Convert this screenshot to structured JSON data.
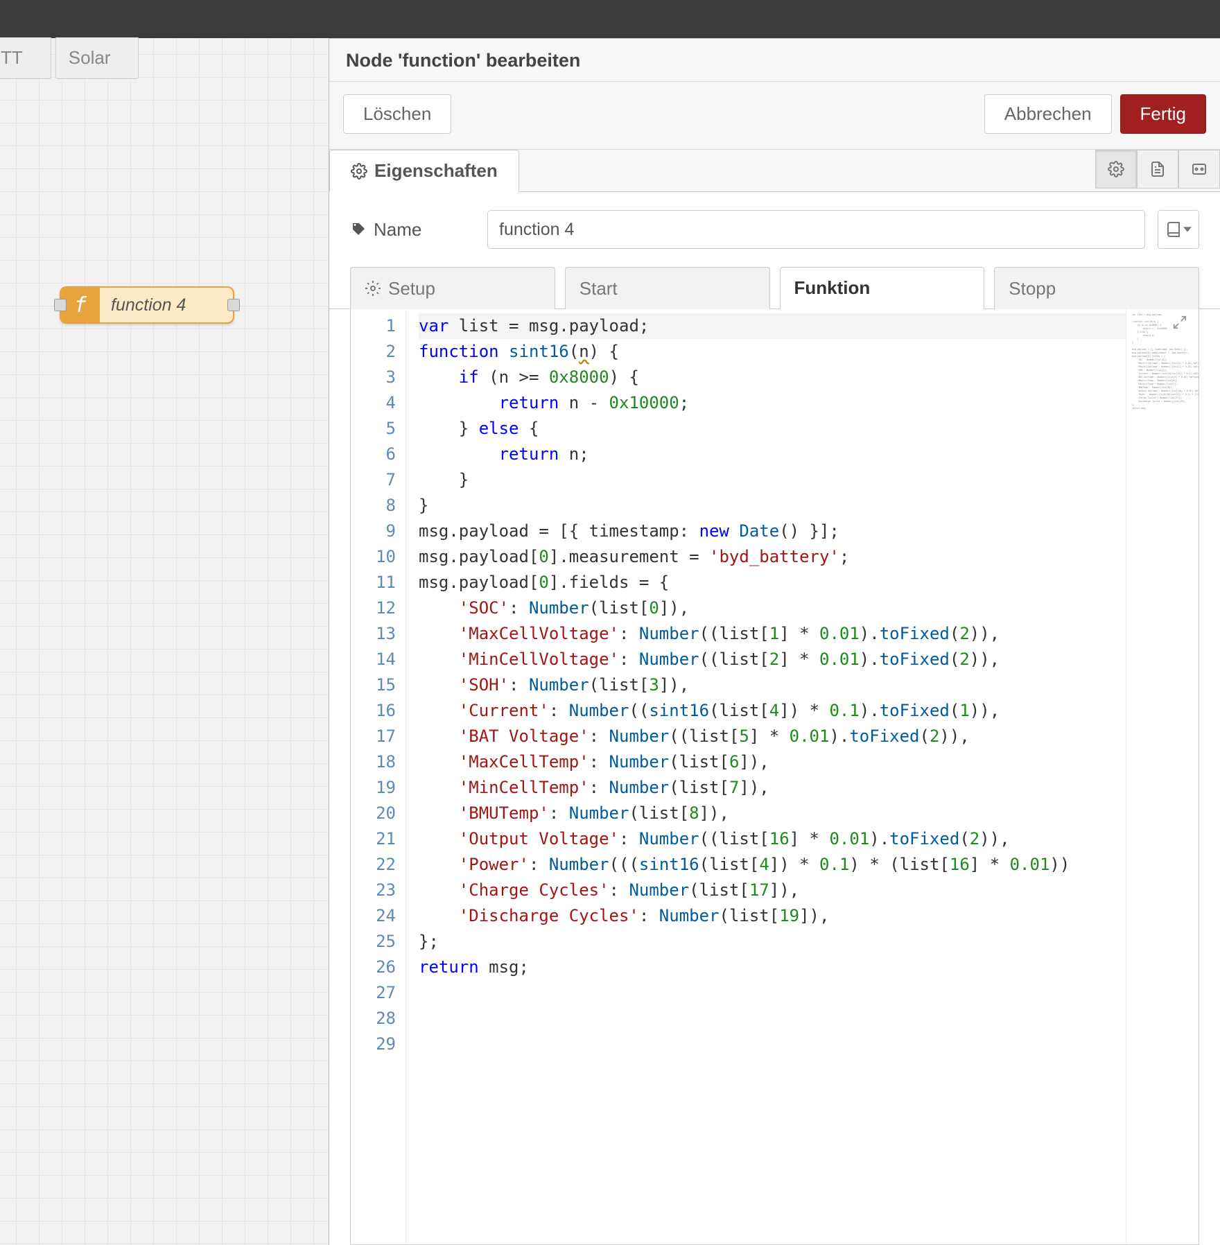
{
  "topbar": {},
  "workspace": {
    "tabs": [
      "TT",
      "Solar"
    ],
    "node": {
      "label": "function 4"
    }
  },
  "panel": {
    "title": "Node 'function' bearbeiten",
    "buttons": {
      "delete": "Löschen",
      "cancel": "Abbrechen",
      "done": "Fertig"
    },
    "propsTab": "Eigenschaften",
    "nameLabel": "Name",
    "nameValue": "function 4",
    "codeTabs": {
      "setup": "Setup",
      "start": "Start",
      "func": "Funktion",
      "stop": "Stopp"
    },
    "code": {
      "lines": [
        "var list = msg.payload;",
        "",
        "function sint16(n) {",
        "    if (n >= 0x8000) {",
        "        return n - 0x10000;",
        "    } else {",
        "        return n;",
        "    }",
        "}",
        "",
        "msg.payload = [{ timestamp: new Date() }];",
        "msg.payload[0].measurement = 'byd_battery';",
        "msg.payload[0].fields = {",
        "    'SOC': Number(list[0]),",
        "    'MaxCellVoltage': Number((list[1] * 0.01).toFixed(2)),",
        "    'MinCellVoltage': Number((list[2] * 0.01).toFixed(2)),",
        "    'SOH': Number(list[3]),",
        "    'Current': Number((sint16(list[4]) * 0.1).toFixed(1)),",
        "    'BAT Voltage': Number((list[5] * 0.01).toFixed(2)),",
        "    'MaxCellTemp': Number(list[6]),",
        "    'MinCellTemp': Number(list[7]),",
        "    'BMUTemp': Number(list[8]),",
        "    'Output Voltage': Number((list[16] * 0.01).toFixed(2)),",
        "    'Power': Number(((sint16(list[4]) * 0.1) * (list[16] * 0.01))",
        "    'Charge Cycles': Number(list[17]),",
        "    'Discharge Cycles': Number(list[19]),",
        "};",
        "return msg;",
        ""
      ],
      "lineCount": 29
    }
  }
}
